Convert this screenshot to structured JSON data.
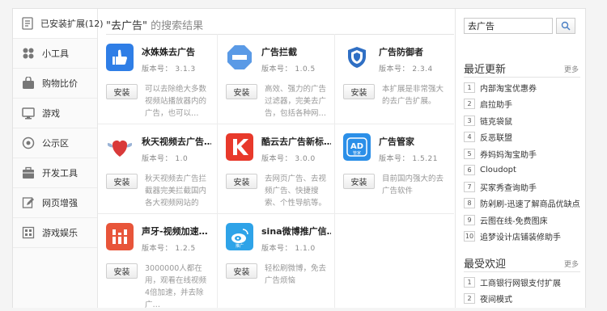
{
  "sidebar": {
    "items": [
      {
        "label": "已安装扩展(12)",
        "icon": "installed-icon"
      },
      {
        "label": "小工具",
        "icon": "tools-icon"
      },
      {
        "label": "购物比价",
        "icon": "shopping-bag-icon"
      },
      {
        "label": "游戏",
        "icon": "game-monitor-icon"
      },
      {
        "label": "公示区",
        "icon": "notice-icon"
      },
      {
        "label": "开发工具",
        "icon": "developer-tools-icon"
      },
      {
        "label": "网页增强",
        "icon": "page-edit-icon"
      },
      {
        "label": "游戏娱乐",
        "icon": "entertainment-grid-icon"
      }
    ]
  },
  "search": {
    "query_quoted": "\"去广告\"",
    "results_suffix": " 的搜索结果",
    "box_value": "去广告"
  },
  "results": [
    {
      "name": "冰姝姝去广告",
      "version": "版本号： 3.1.3",
      "install": "安装",
      "desc": "可以去除绝大多数视频站播放器内的广告，也可以…",
      "icon": "thumbs-up-icon",
      "color": "#2f7ee6"
    },
    {
      "name": "广告拦截",
      "version": "版本号： 1.0.5",
      "install": "安装",
      "desc": "高效、强力的广告过滤器，完美去广告，包括各种网…",
      "icon": "block-octagon-icon",
      "color": "#5a9ae6"
    },
    {
      "name": "广告防御者",
      "version": "版本号： 2.3.4",
      "install": "安装",
      "desc": "本扩展是非常强大的去广告扩展。",
      "icon": "shield-icon",
      "color": "#2f6fc4"
    },
    {
      "name": "秋天视频去广告…",
      "version": "版本号： 1.0",
      "install": "安装",
      "desc": "秋天视频去广告拦截器完美拦截国内各大视频网站的",
      "icon": "winged-heart-icon",
      "color": "#d93a3a"
    },
    {
      "name": "酷云去广告新标…",
      "version": "版本号： 3.0.0",
      "install": "安装",
      "desc": "去网页广告、去视频广告、快捷搜索、个性导航等。",
      "icon": "k-logo-icon",
      "color": "#e8392b"
    },
    {
      "name": "广告管家",
      "version": "版本号： 1.5.21",
      "install": "安装",
      "desc": "目前国内强大的去广告软件",
      "icon": "ad-manager-icon",
      "color": "#2b8fe8"
    },
    {
      "name": "声牙-视频加速…",
      "version": "版本号： 1.2.5",
      "install": "安装",
      "desc": "3000000人都在用，观看在线视频4倍加速，并去除广…",
      "icon": "sound-bars-icon",
      "color": "#e8553a"
    },
    {
      "name": "sina微博推广信…",
      "version": "版本号： 1.1.0",
      "install": "安装",
      "desc": "轻松刷微博，免去广告烦恼",
      "icon": "weibo-icon",
      "color": "#2ea3e8"
    }
  ],
  "recent": {
    "title": "最近更新",
    "more": "更多",
    "items": [
      {
        "num": "1",
        "text": "内部淘宝优惠券"
      },
      {
        "num": "2",
        "text": "启拉助手"
      },
      {
        "num": "3",
        "text": "链克袋鼠"
      },
      {
        "num": "4",
        "text": "反恶联盟"
      },
      {
        "num": "5",
        "text": "券妈妈淘宝助手"
      },
      {
        "num": "6",
        "text": "Cloudopt"
      },
      {
        "num": "7",
        "text": "买家秀查询助手"
      },
      {
        "num": "8",
        "text": "防剁刷-迅速了解商品优缺点"
      },
      {
        "num": "9",
        "text": "云图在线-免费图床"
      },
      {
        "num": "10",
        "text": "追梦设计店铺装修助手"
      }
    ]
  },
  "popular": {
    "title": "最受欢迎",
    "more": "更多",
    "items": [
      {
        "num": "1",
        "text": "工商银行网银支付扩展"
      },
      {
        "num": "2",
        "text": "夜间模式"
      }
    ]
  }
}
